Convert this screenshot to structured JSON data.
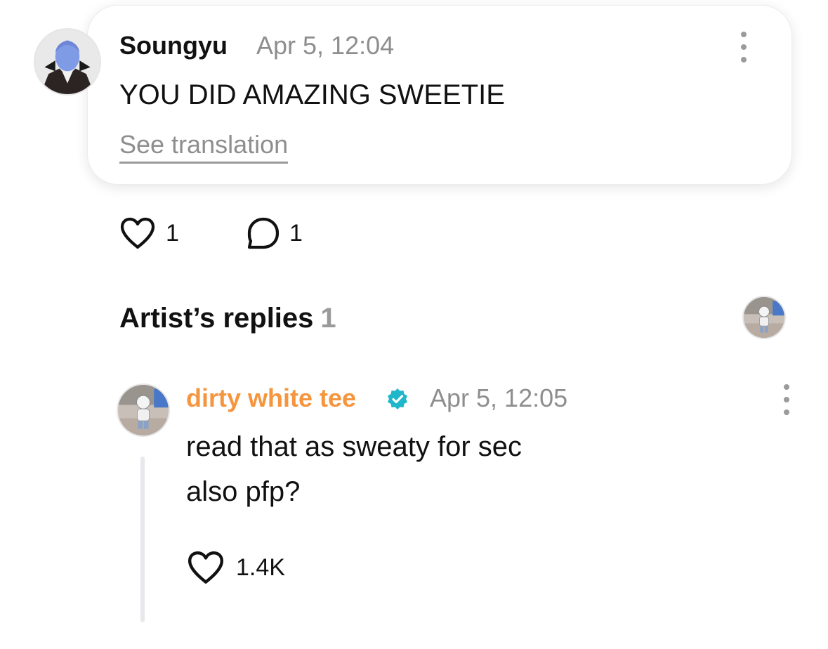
{
  "comment": {
    "username": "Soungyu",
    "timestamp": "Apr 5, 12:04",
    "text": "YOU DID AMAZING SWEETIE",
    "translate_label": "See translation",
    "like_count": "1",
    "reply_count": "1"
  },
  "artist_replies": {
    "title": "Artist’s replies",
    "count": "1"
  },
  "reply": {
    "username": "dirty white tee",
    "verified": true,
    "timestamp": "Apr 5, 12:05",
    "lines": [
      "read that as sweaty for sec",
      "also pfp?"
    ],
    "like_count": "1.4K"
  },
  "colors": {
    "artist_name": "#f5953e",
    "verified_badge": "#1fb7c9",
    "muted_text": "#8e8e8e"
  }
}
